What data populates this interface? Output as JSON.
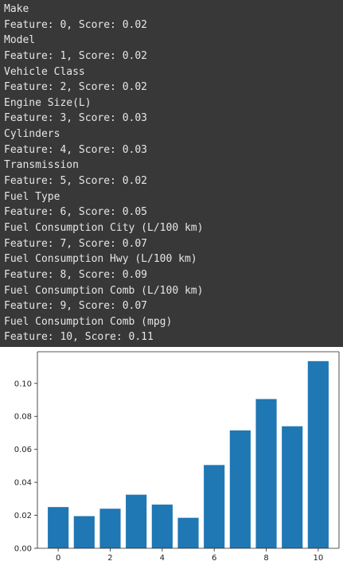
{
  "output": {
    "lines": [
      "Make",
      "Feature: 0, Score: 0.02",
      "Model",
      "Feature: 1, Score: 0.02",
      "Vehicle Class",
      "Feature: 2, Score: 0.02",
      "Engine Size(L)",
      "Feature: 3, Score: 0.03",
      "Cylinders",
      "Feature: 4, Score: 0.03",
      "Transmission",
      "Feature: 5, Score: 0.02",
      "Fuel Type",
      "Feature: 6, Score: 0.05",
      "Fuel Consumption City (L/100 km)",
      "Feature: 7, Score: 0.07",
      "Fuel Consumption Hwy (L/100 km)",
      "Feature: 8, Score: 0.09",
      "Fuel Consumption Comb (L/100 km)",
      "Feature: 9, Score: 0.07",
      "Fuel Consumption Comb (mpg)",
      "Feature: 10, Score: 0.11"
    ]
  },
  "colors": {
    "background": "#383838",
    "text": "#e6e6e6",
    "plot_background": "#ffffff",
    "bar": "#1f77b4",
    "axis": "#222222"
  },
  "chart_data": {
    "type": "bar",
    "x": [
      0,
      1,
      2,
      3,
      4,
      5,
      6,
      7,
      8,
      9,
      10
    ],
    "values": [
      0.025,
      0.0195,
      0.024,
      0.0325,
      0.0265,
      0.0185,
      0.0505,
      0.0715,
      0.0905,
      0.074,
      0.1135
    ],
    "xticks": [
      0,
      2,
      4,
      6,
      8,
      10
    ],
    "yticks": [
      0.0,
      0.02,
      0.04,
      0.06,
      0.08,
      0.1
    ],
    "ytick_labels": [
      "0.00",
      "0.02",
      "0.04",
      "0.06",
      "0.08",
      "0.10"
    ],
    "xlim": [
      -0.8,
      10.8
    ],
    "ylim": [
      0,
      0.1192
    ],
    "title": "",
    "xlabel": "",
    "ylabel": "",
    "grid": false
  }
}
